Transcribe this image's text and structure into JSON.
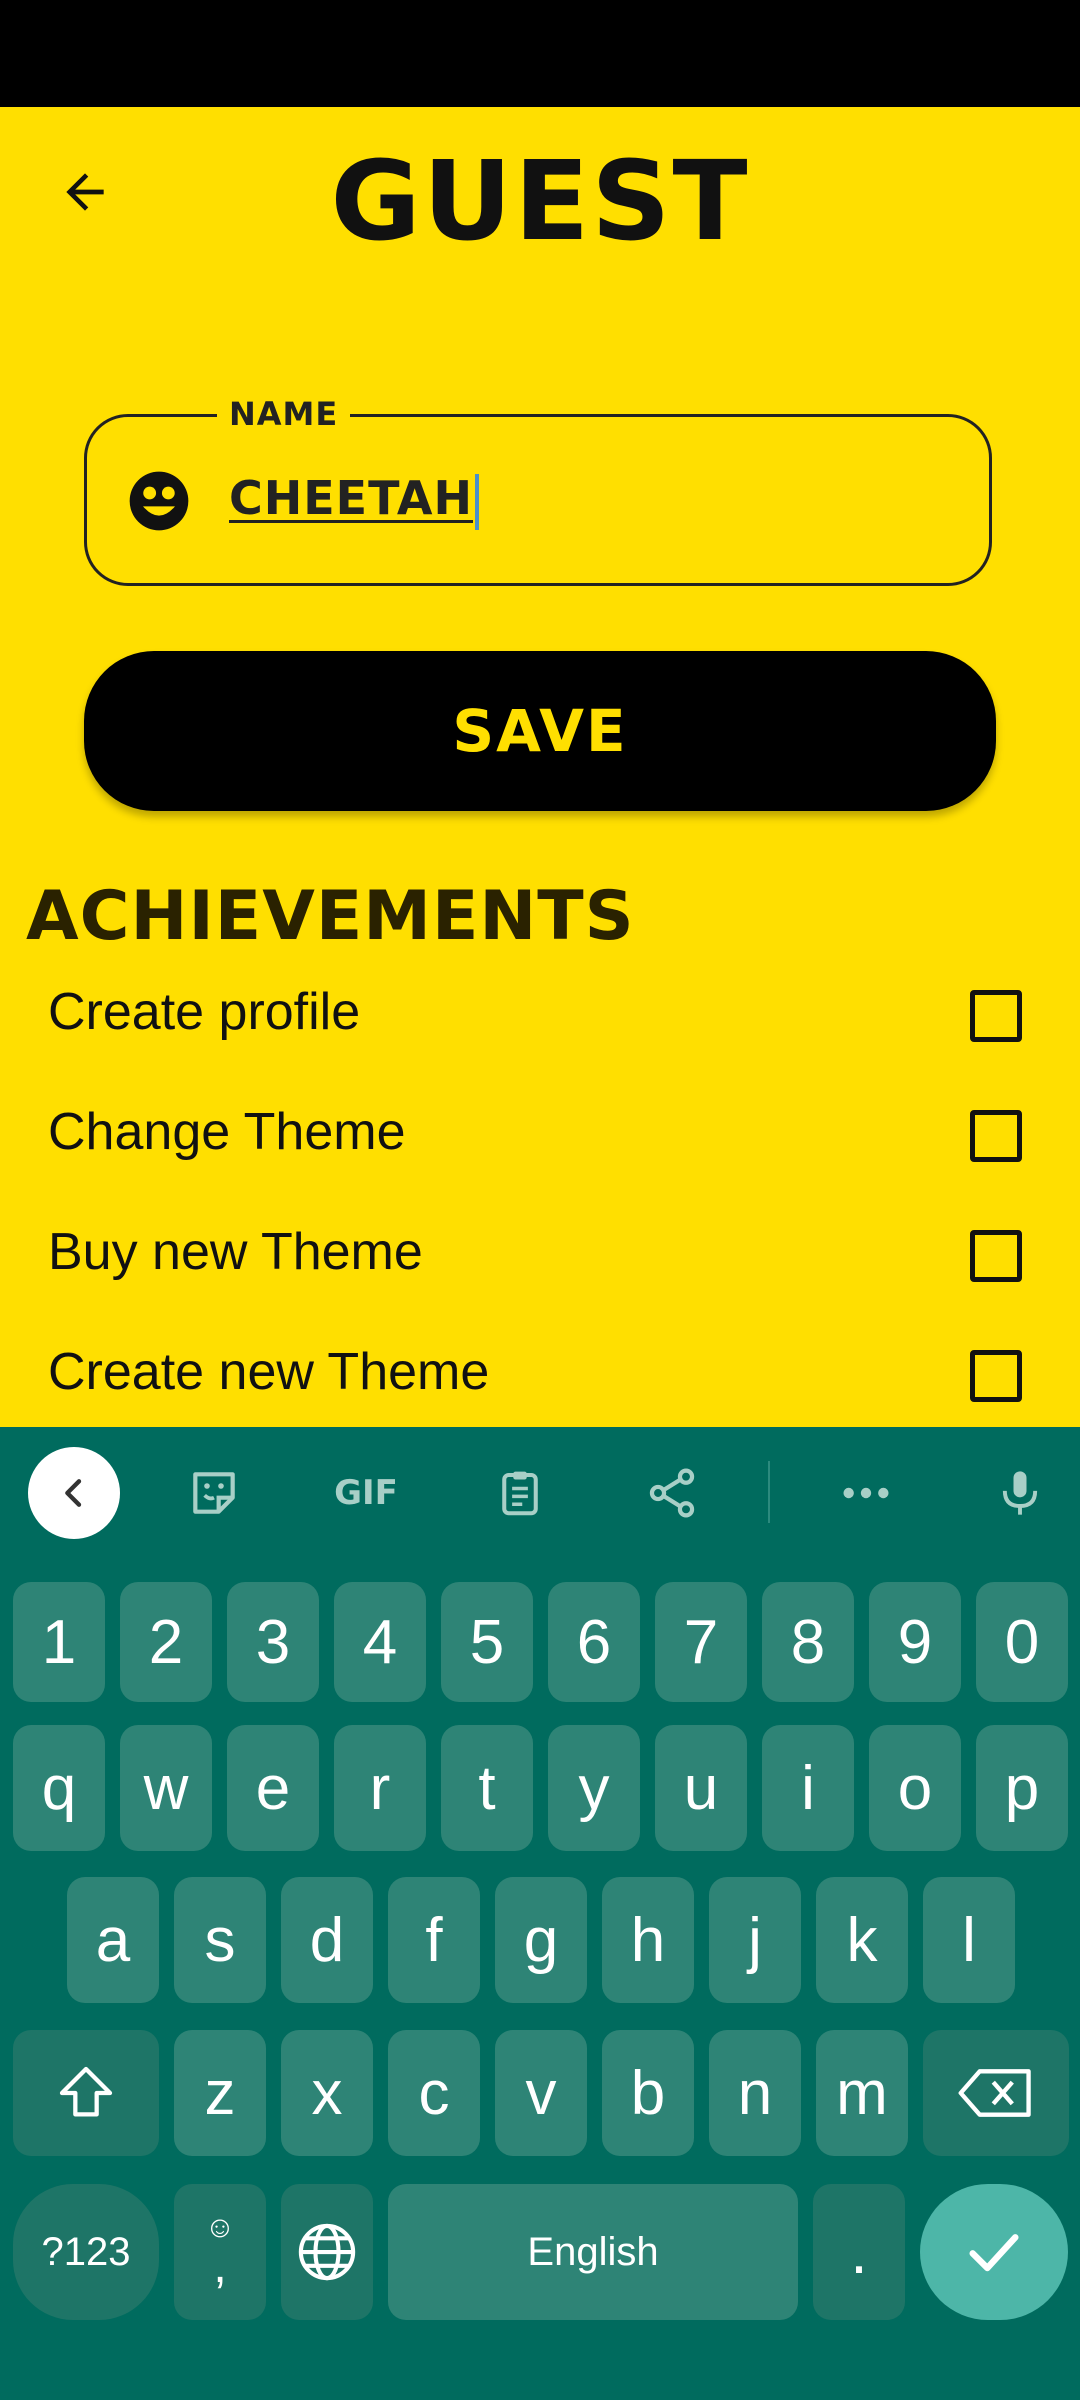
{
  "app": {
    "title": "GUEST",
    "name_field": {
      "label": "NAME",
      "value": "CHEETAH"
    },
    "save_label": "SAVE",
    "achievements_heading": "ACHIEVEMENTS",
    "achievements": [
      {
        "label": "Create profile",
        "checked": false
      },
      {
        "label": "Change Theme",
        "checked": false
      },
      {
        "label": "Buy new Theme",
        "checked": false
      },
      {
        "label": "Create new Theme",
        "checked": false
      }
    ],
    "colors": {
      "background": "#FFDF00",
      "button": "#000000",
      "button_text": "#FFDF00"
    }
  },
  "keyboard": {
    "toolbar": {
      "collapse": "chevron-left-icon",
      "sticker": "sticker-icon",
      "gif": "GIF",
      "clipboard": "clipboard-icon",
      "share": "share-icon",
      "more": "more-icon",
      "mic": "mic-icon"
    },
    "row_numbers": [
      "1",
      "2",
      "3",
      "4",
      "5",
      "6",
      "7",
      "8",
      "9",
      "0"
    ],
    "row_top": [
      "q",
      "w",
      "e",
      "r",
      "t",
      "y",
      "u",
      "i",
      "o",
      "p"
    ],
    "row_middle": [
      "a",
      "s",
      "d",
      "f",
      "g",
      "h",
      "j",
      "k",
      "l"
    ],
    "row_bottom": [
      "z",
      "x",
      "c",
      "v",
      "b",
      "n",
      "m"
    ],
    "symbols_label": "?123",
    "comma": ",",
    "emoji": "☺",
    "space_label": "English",
    "period": ".",
    "colors": {
      "background": "#006B5E",
      "key": "#2E8476",
      "enter": "#4DB6A8"
    }
  }
}
